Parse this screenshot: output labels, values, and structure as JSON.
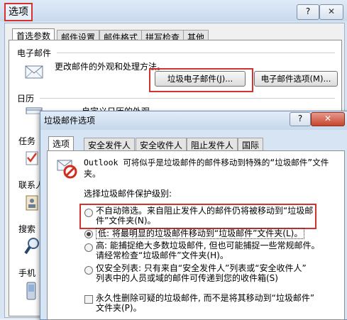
{
  "outer": {
    "title": "选项",
    "help": "?",
    "close": "✕",
    "tabs": [
      "首选参数",
      "邮件设置",
      "邮件格式",
      "拼写检查",
      "其他"
    ],
    "email_section": {
      "heading": "电子邮件",
      "desc": "更改邮件的外观和处理方法。",
      "junk_button": "垃圾电子邮件(J)...",
      "options_button": "电子邮件选项(M)..."
    },
    "calendar_section": {
      "heading": "日历",
      "desc": "自定义日历的外观。"
    },
    "sidebar_labels": {
      "tasks": "任务",
      "contacts": "联系人",
      "search": "搜索",
      "mobile": "手机"
    }
  },
  "inner": {
    "title": "垃圾邮件选项",
    "help": "?",
    "close": "✕",
    "tabs": [
      "选项",
      "安全发件人",
      "安全收件人",
      "阻止发件人",
      "国际"
    ],
    "intro_line1": "Outlook 可将似乎是垃圾邮件的邮件移动到特殊的“垃圾邮件”文件",
    "intro_line2": "夹。",
    "level_prompt": "选择垃圾邮件保护级别:",
    "options": [
      {
        "line1": "不自动筛选。来自阻止发件人的邮件仍将被移动到“垃圾邮",
        "line2": "件”文件夹(N)。",
        "selected": false
      },
      {
        "line1": "低: 将最明显的垃圾邮件移动到“垃圾邮件”文件夹(L)。",
        "line2": "",
        "selected": true
      },
      {
        "line1": "高: 能捕捉绝大多数垃圾邮件, 但也可能捕捉一些常规邮件。",
        "line2": "请经常检查“垃圾邮件”文件夹(H)。",
        "selected": false
      },
      {
        "line1": "仅安全列表: 只有来自“安全发件人”列表或“安全收件人”",
        "line2": "列表中的人员或域的邮件可传递到您的收件箱(S)",
        "selected": false
      }
    ],
    "delete_check": {
      "line1": "永久性删除可疑的垃圾邮件, 而不是将其移动到“垃圾邮件”",
      "line2": "文件夹(P)。",
      "checked": false
    }
  }
}
